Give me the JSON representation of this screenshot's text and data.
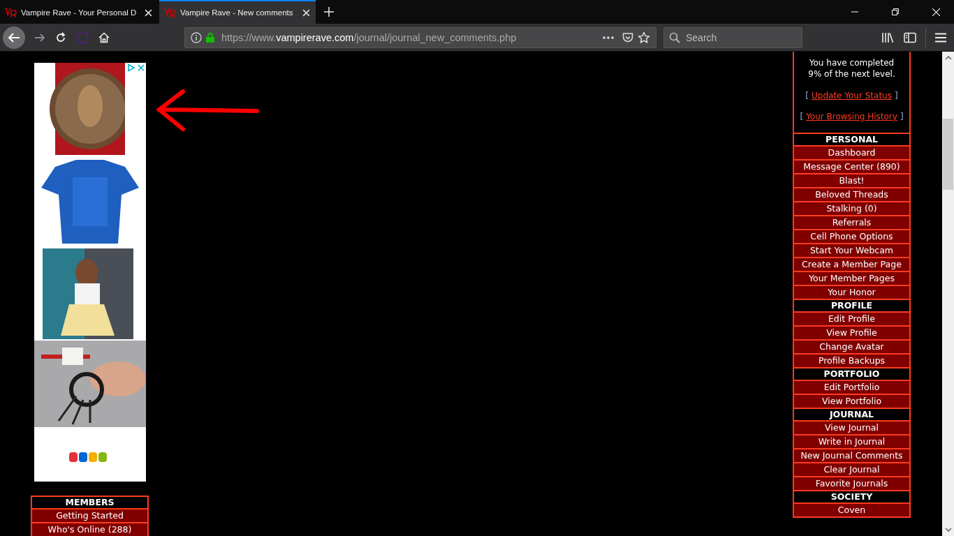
{
  "browser": {
    "tabs": [
      {
        "title": "Vampire Rave - Your Personal D",
        "selected": false
      },
      {
        "title": "Vampire Rave - New comments",
        "selected": true
      }
    ],
    "url": {
      "scheme": "https://www.",
      "domain": "vampirerave.com",
      "path": "/journal/journal_new_comments.php"
    },
    "search": {
      "placeholder": "Search"
    }
  },
  "page": {
    "left_menu": [
      {
        "header": "MEMBERS",
        "items": [
          "Getting Started",
          "Who's Online (288)"
        ]
      }
    ],
    "status": {
      "lines": [
        "You have completed",
        "9% of the next level."
      ],
      "links": [
        {
          "before": "[",
          "label": "Update Your Status",
          "after": "]"
        },
        {
          "before": "[",
          "label": "Your Browsing History",
          "after": "]"
        }
      ]
    },
    "right_menu": [
      {
        "header": "PERSONAL",
        "items": [
          "Dashboard",
          "Message Center (890)",
          "Blast!",
          "Beloved Threads",
          "Stalking (0)",
          "Referrals",
          "Cell Phone Options",
          "Start Your Webcam",
          "Create a Member Page",
          "Your Member Pages",
          "Your Honor"
        ]
      },
      {
        "header": "PROFILE",
        "items": [
          "Edit Profile",
          "View Profile",
          "Change Avatar",
          "Profile Backups"
        ]
      },
      {
        "header": "PORTFOLIO",
        "items": [
          "Edit Portfolio",
          "View Portfolio"
        ]
      },
      {
        "header": "JOURNAL",
        "items": [
          "View Journal",
          "Write in Journal",
          "New Journal Comments",
          "Clear Journal",
          "Favorite Journals"
        ]
      },
      {
        "header": "SOCIETY",
        "items": [
          "Coven"
        ]
      }
    ]
  }
}
